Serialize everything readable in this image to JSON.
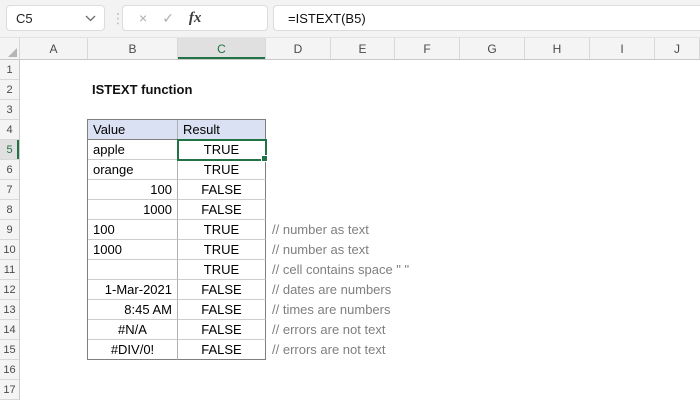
{
  "formula_bar": {
    "name_box_value": "C5",
    "cancel_icon": "×",
    "enter_icon": "✓",
    "fx_label": "fx",
    "formula": "=ISTEXT(B5)"
  },
  "sheet": {
    "column_headers": [
      "A",
      "B",
      "C",
      "D",
      "E",
      "F",
      "G",
      "H",
      "I",
      "J"
    ],
    "selected_column": "C",
    "row_headers": [
      "1",
      "2",
      "3",
      "4",
      "5",
      "6",
      "7",
      "8",
      "9",
      "10",
      "11",
      "12",
      "13",
      "14",
      "15",
      "16",
      "17"
    ],
    "selected_row": "5",
    "title": "ISTEXT function",
    "selection": {
      "cell": "C5"
    },
    "table": {
      "first_row": 5,
      "headers": [
        "Value",
        "Result"
      ],
      "rows": [
        {
          "value": "apple",
          "align": "left",
          "result": "TRUE",
          "comment": ""
        },
        {
          "value": "orange",
          "align": "left",
          "result": "TRUE",
          "comment": ""
        },
        {
          "value": "100",
          "align": "right",
          "result": "FALSE",
          "comment": ""
        },
        {
          "value": "1000",
          "align": "right",
          "result": "FALSE",
          "comment": ""
        },
        {
          "value": "100",
          "align": "left",
          "result": "TRUE",
          "comment": "// number as text"
        },
        {
          "value": "1000",
          "align": "left",
          "result": "TRUE",
          "comment": "// number as text"
        },
        {
          "value": " ",
          "align": "left",
          "result": "TRUE",
          "comment": "// cell contains space \" \""
        },
        {
          "value": "1-Mar-2021",
          "align": "right",
          "result": "FALSE",
          "comment": "// dates are numbers"
        },
        {
          "value": "8:45 AM",
          "align": "right",
          "result": "FALSE",
          "comment": "// times are numbers"
        },
        {
          "value": "#N/A",
          "align": "center",
          "result": "FALSE",
          "comment": "// errors are not text"
        },
        {
          "value": "#DIV/0!",
          "align": "center",
          "result": "FALSE",
          "comment": "// errors are not text"
        }
      ]
    }
  },
  "colors": {
    "accent_green": "#217346",
    "table_header_fill": "#D9E1F2",
    "comment_text": "#7F7F7F"
  }
}
